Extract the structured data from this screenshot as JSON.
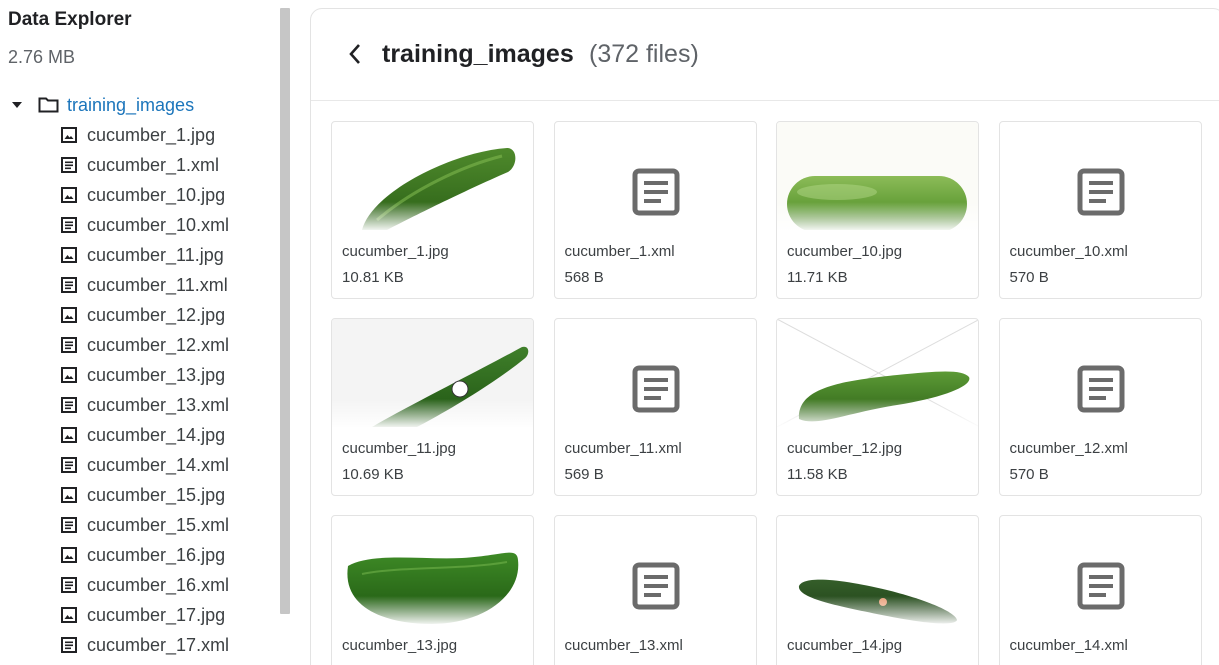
{
  "sidebar": {
    "title": "Data Explorer",
    "size": "2.76 MB",
    "root": {
      "label": "training_images",
      "icon": "folder-icon",
      "expanded": true
    },
    "items": [
      {
        "label": "cucumber_1.jpg",
        "icon": "image-icon"
      },
      {
        "label": "cucumber_1.xml",
        "icon": "document-icon"
      },
      {
        "label": "cucumber_10.jpg",
        "icon": "image-icon"
      },
      {
        "label": "cucumber_10.xml",
        "icon": "document-icon"
      },
      {
        "label": "cucumber_11.jpg",
        "icon": "image-icon"
      },
      {
        "label": "cucumber_11.xml",
        "icon": "document-icon"
      },
      {
        "label": "cucumber_12.jpg",
        "icon": "image-icon"
      },
      {
        "label": "cucumber_12.xml",
        "icon": "document-icon"
      },
      {
        "label": "cucumber_13.jpg",
        "icon": "image-icon"
      },
      {
        "label": "cucumber_13.xml",
        "icon": "document-icon"
      },
      {
        "label": "cucumber_14.jpg",
        "icon": "image-icon"
      },
      {
        "label": "cucumber_14.xml",
        "icon": "document-icon"
      },
      {
        "label": "cucumber_15.jpg",
        "icon": "image-icon"
      },
      {
        "label": "cucumber_15.xml",
        "icon": "document-icon"
      },
      {
        "label": "cucumber_16.jpg",
        "icon": "image-icon"
      },
      {
        "label": "cucumber_16.xml",
        "icon": "document-icon"
      },
      {
        "label": "cucumber_17.jpg",
        "icon": "image-icon"
      },
      {
        "label": "cucumber_17.xml",
        "icon": "document-icon"
      }
    ]
  },
  "main": {
    "title": "training_images",
    "count": "(372 files)",
    "cards": [
      {
        "name": "cucumber_1.jpg",
        "size": "10.81 KB",
        "kind": "image"
      },
      {
        "name": "cucumber_1.xml",
        "size": "568 B",
        "kind": "xml"
      },
      {
        "name": "cucumber_10.jpg",
        "size": "11.71 KB",
        "kind": "image"
      },
      {
        "name": "cucumber_10.xml",
        "size": "570 B",
        "kind": "xml"
      },
      {
        "name": "cucumber_11.jpg",
        "size": "10.69 KB",
        "kind": "image"
      },
      {
        "name": "cucumber_11.xml",
        "size": "569 B",
        "kind": "xml"
      },
      {
        "name": "cucumber_12.jpg",
        "size": "11.58 KB",
        "kind": "image"
      },
      {
        "name": "cucumber_12.xml",
        "size": "570 B",
        "kind": "xml"
      },
      {
        "name": "cucumber_13.jpg",
        "size": "",
        "kind": "image"
      },
      {
        "name": "cucumber_13.xml",
        "size": "",
        "kind": "xml"
      },
      {
        "name": "cucumber_14.jpg",
        "size": "",
        "kind": "image"
      },
      {
        "name": "cucumber_14.xml",
        "size": "",
        "kind": "xml"
      }
    ]
  },
  "colors": {
    "link": "#1b75bb",
    "icon": "#5f6368",
    "cucumber_dark": "#2f6b1e",
    "cucumber_light": "#6fa83e"
  }
}
